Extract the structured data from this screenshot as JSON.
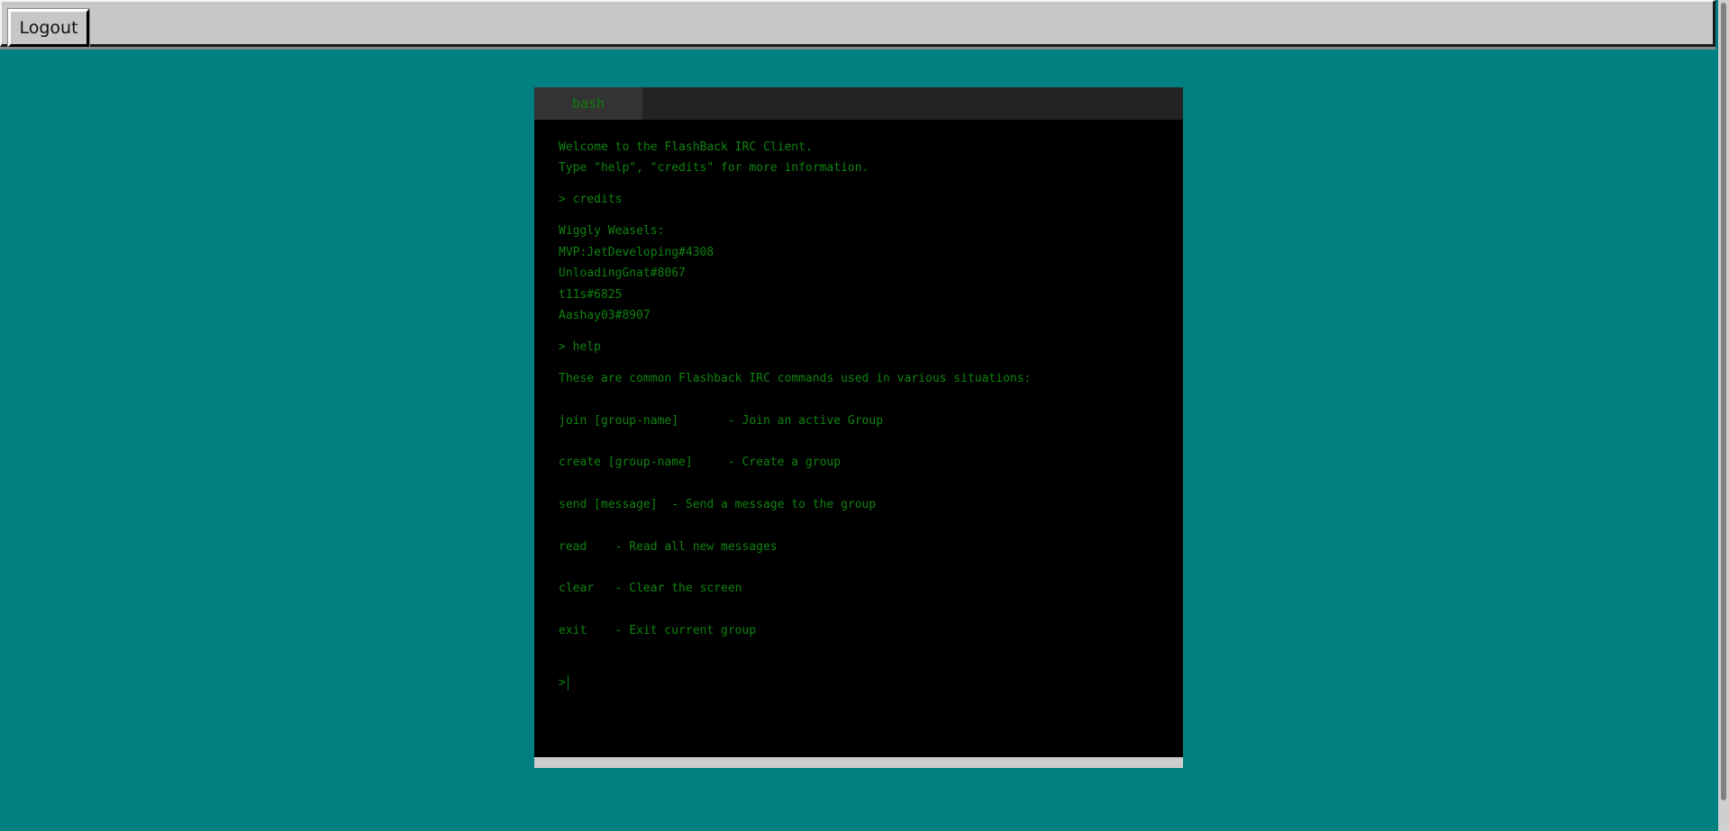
{
  "topbar": {
    "logout_label": "Logout"
  },
  "terminal": {
    "tab_label": "bash",
    "lines": [
      "Welcome to the FlashBack IRC Client.",
      "Type \"help\", \"credits\" for more information.",
      "> credits",
      "Wiggly Weasels:",
      "MVP:JetDeveloping#4308",
      "UnloadingGnat#8067",
      "t11s#6825",
      "Aashay03#8907",
      "> help",
      "These are common Flashback IRC commands used in various situations:",
      "join [group-name]       - Join an active Group",
      "create [group-name]     - Create a group",
      "send [message]  - Send a message to the group",
      "read    - Read all new messages",
      "clear   - Clear the screen",
      "exit    - Exit current group"
    ],
    "prompt_symbol": ">",
    "input_value": ""
  },
  "colors": {
    "background": "#008080",
    "terminal_text": "#0f820f",
    "terminal_bg": "#000000",
    "topbar": "#c8c6c8"
  }
}
